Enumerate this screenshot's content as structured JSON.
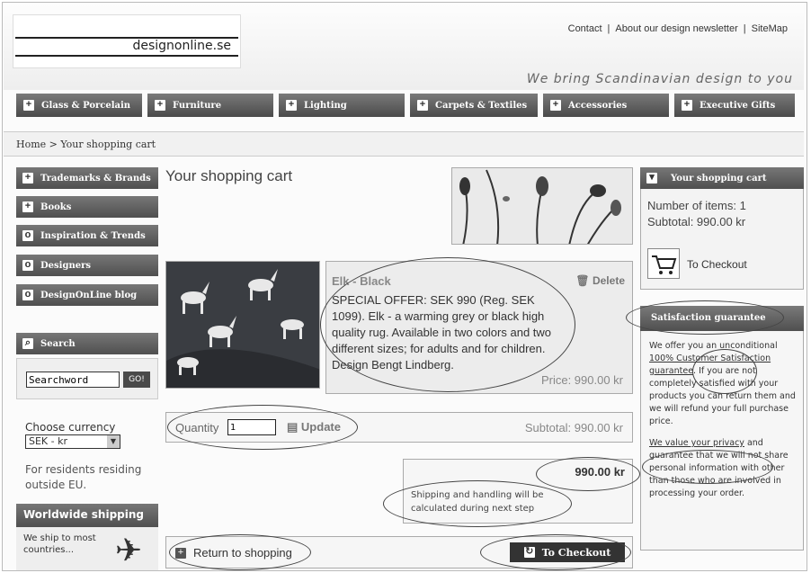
{
  "header": {
    "logo_text": "designonline.se",
    "top_links": [
      "Contact",
      "About our design newsletter",
      "SiteMap"
    ],
    "tagline": "We bring Scandinavian design to you"
  },
  "nav": [
    "Glass & Porcelain",
    "Furniture",
    "Lighting",
    "Carpets & Textiles",
    "Accessories",
    "Executive Gifts"
  ],
  "breadcrumb": "Home > Your shopping cart",
  "sidebar": {
    "items": [
      "Trademarks & Brands",
      "Books",
      "Inspiration & Trends",
      "Designers",
      "DesignOnLine blog"
    ],
    "search_title": "Search",
    "search_value": "Searchword",
    "search_button": "GO!",
    "currency_label": "Choose currency",
    "currency_value": "SEK - kr",
    "residents_note": "For residents residing outside EU.",
    "shipping_title": "Worldwide shipping",
    "shipping_text": "We ship to most countries..."
  },
  "main": {
    "title": "Your shopping cart",
    "product": {
      "name": "Elk - Black",
      "delete_label": "Delete",
      "description": "SPECIAL OFFER: SEK 990 (Reg. SEK 1099). Elk - a warming grey or black high quality rug. Available in two colors and two different sizes; for adults and for children. Design Bengt Lindberg.",
      "price": "Price: 990.00 kr"
    },
    "quantity_label": "Quantity",
    "quantity_value": "1",
    "update_label": "Update",
    "subtotal": "Subtotal: 990.00 kr",
    "total": "990.00 kr",
    "shipping_note": "Shipping and handling will be calculated during next step",
    "return_label": "Return to shopping",
    "checkout_label": "To Checkout"
  },
  "cart_panel": {
    "title": "Your shopping cart",
    "items_line": "Number of items: 1",
    "subtotal_line": "Subtotal: 990.00 kr",
    "checkout_label": "To Checkout"
  },
  "guarantee": {
    "title": "Satisfaction guarantee",
    "p1_pre": "We offer you an unconditional ",
    "p1_link": "100% Customer Satisfaction guarantee",
    "p1_post": ". If you are not completely satisfied with your products you can return them and we will refund your full purchase price.",
    "p2_link": "We value your privacy",
    "p2_post": " and guarantee that we will not share personal information with other than those who are involved in processing your order."
  }
}
